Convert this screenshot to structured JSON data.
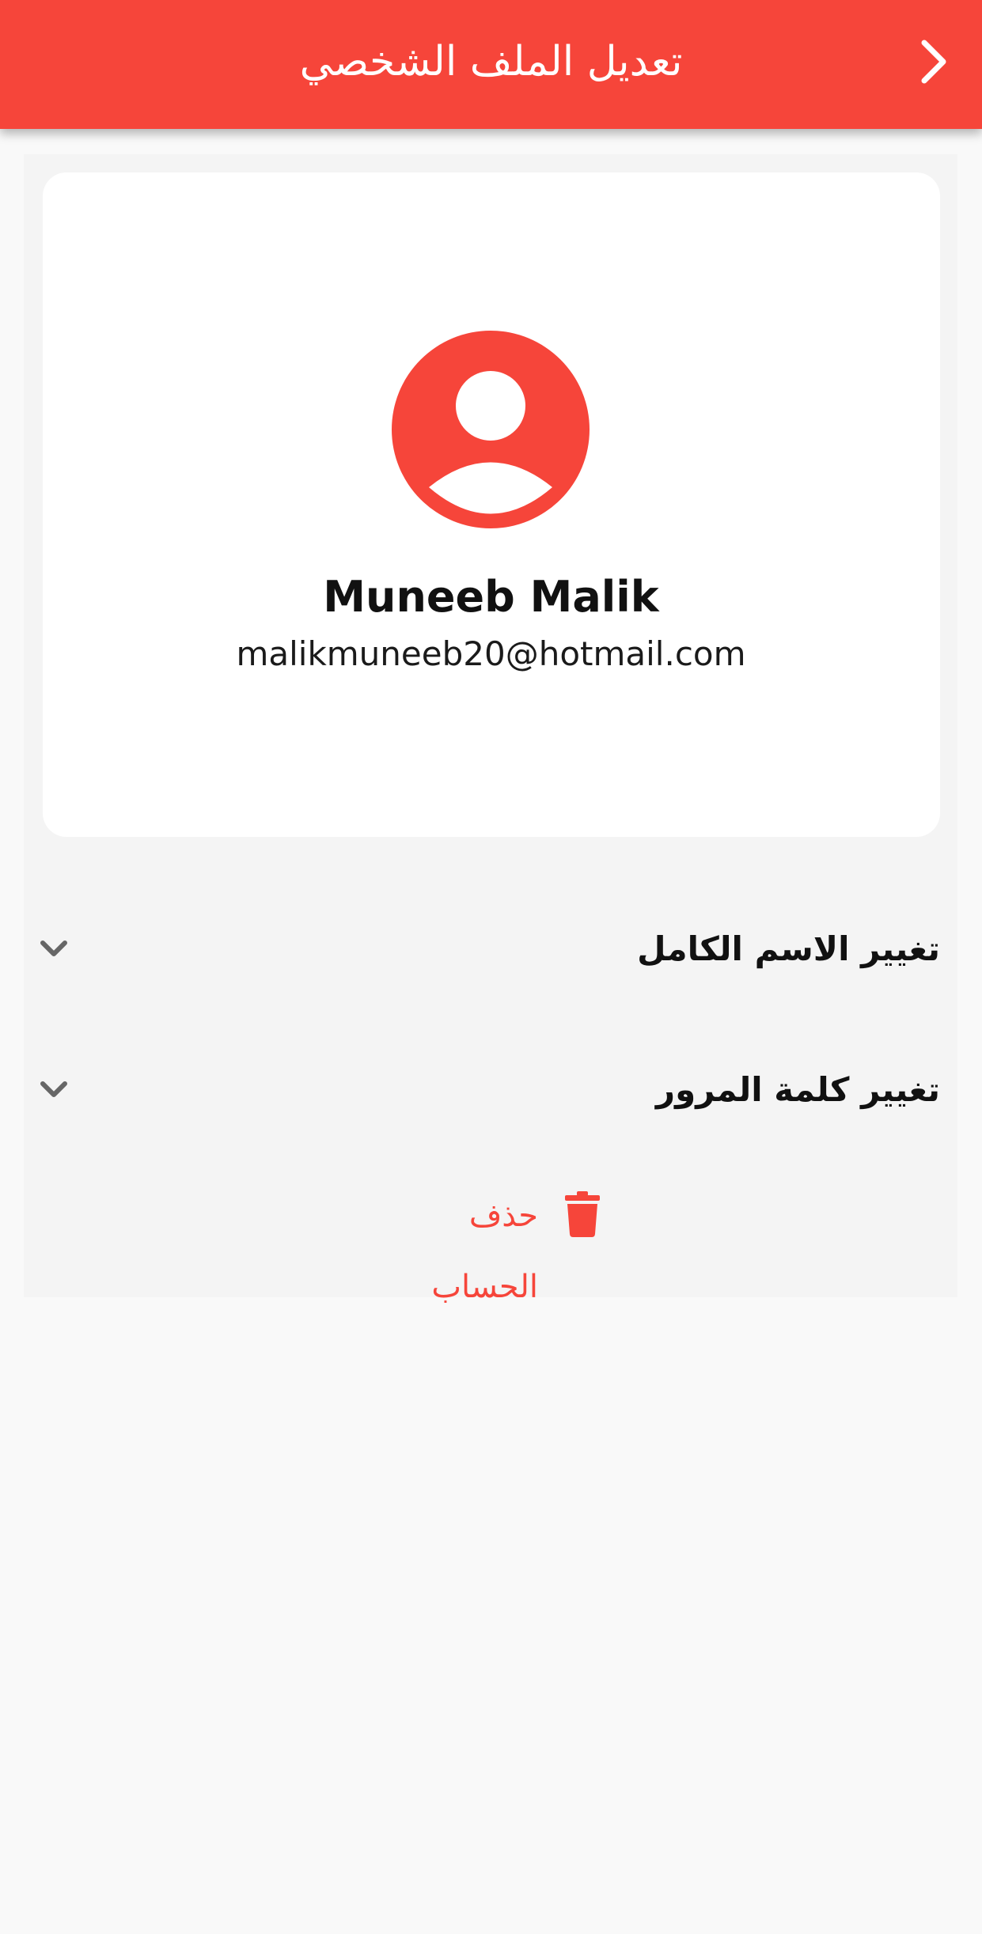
{
  "appbar": {
    "title": "تعديل الملف الشخصي",
    "back_icon": "chevron-right-icon",
    "color": "#f6453a"
  },
  "profile": {
    "avatar_icon": "account-circle-icon",
    "name": "Muneeb Malik",
    "email": "malikmuneeb20@hotmail.com"
  },
  "sections": [
    {
      "label": "تغيير الاسم الكامل",
      "icon": "chevron-down-icon"
    },
    {
      "label": "تغيير كلمة المرور",
      "icon": "chevron-down-icon"
    }
  ],
  "delete_account": {
    "label": "حذف الحساب",
    "icon": "trash-icon",
    "color": "#f6453a"
  }
}
